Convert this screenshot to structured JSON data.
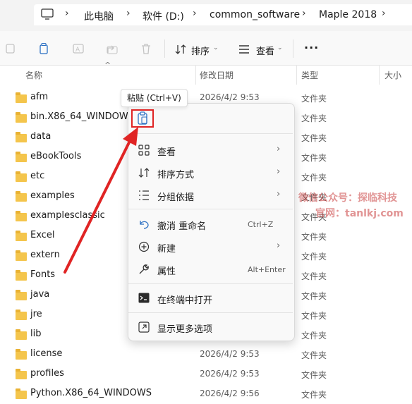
{
  "breadcrumb": {
    "items": [
      "此电脑",
      "软件 (D:)",
      "common_software",
      "Maple 2018"
    ]
  },
  "toolbar": {
    "sort_label": "排序",
    "view_label": "查看",
    "more_label": "···"
  },
  "columns": {
    "name": "名称",
    "date": "修改日期",
    "type": "类型",
    "size": "大小"
  },
  "files": [
    {
      "name": "afm",
      "date": "2026/4/2 9:53",
      "type": "文件夹"
    },
    {
      "name": "bin.X86_64_WINDOWS",
      "date": "",
      "type": "文件夹"
    },
    {
      "name": "data",
      "date": "",
      "type": "文件夹"
    },
    {
      "name": "eBookTools",
      "date": "",
      "type": "文件夹"
    },
    {
      "name": "etc",
      "date": "",
      "type": "文件夹"
    },
    {
      "name": "examples",
      "date": "",
      "type": "文件夹"
    },
    {
      "name": "examplesclassic",
      "date": "",
      "type": "文件夹"
    },
    {
      "name": "Excel",
      "date": "",
      "type": "文件夹"
    },
    {
      "name": "extern",
      "date": "",
      "type": "文件夹"
    },
    {
      "name": "Fonts",
      "date": "",
      "type": "文件夹"
    },
    {
      "name": "java",
      "date": "",
      "type": "文件夹"
    },
    {
      "name": "jre",
      "date": "",
      "type": "文件夹"
    },
    {
      "name": "lib",
      "date": "",
      "type": "文件夹"
    },
    {
      "name": "license",
      "date": "2026/4/2 9:53",
      "type": "文件夹"
    },
    {
      "name": "profiles",
      "date": "2026/4/2 9:53",
      "type": "文件夹"
    },
    {
      "name": "Python.X86_64_WINDOWS",
      "date": "2026/4/2 9:56",
      "type": "文件夹"
    }
  ],
  "context_menu": {
    "tooltip": "粘贴 (Ctrl+V)",
    "view": "查看",
    "sort": "排序方式",
    "group": "分组依据",
    "undo": "撤消 重命名",
    "undo_shortcut": "Ctrl+Z",
    "new": "新建",
    "properties": "属性",
    "properties_shortcut": "Alt+Enter",
    "terminal": "在终端中打开",
    "more": "显示更多选项"
  },
  "watermark": {
    "line1": "微信公众号：探临科技",
    "line2": "官网：tanlkj.com"
  },
  "colors": {
    "accent": "#0067c0",
    "highlight": "#e02424",
    "folder": "#f4c54c"
  }
}
